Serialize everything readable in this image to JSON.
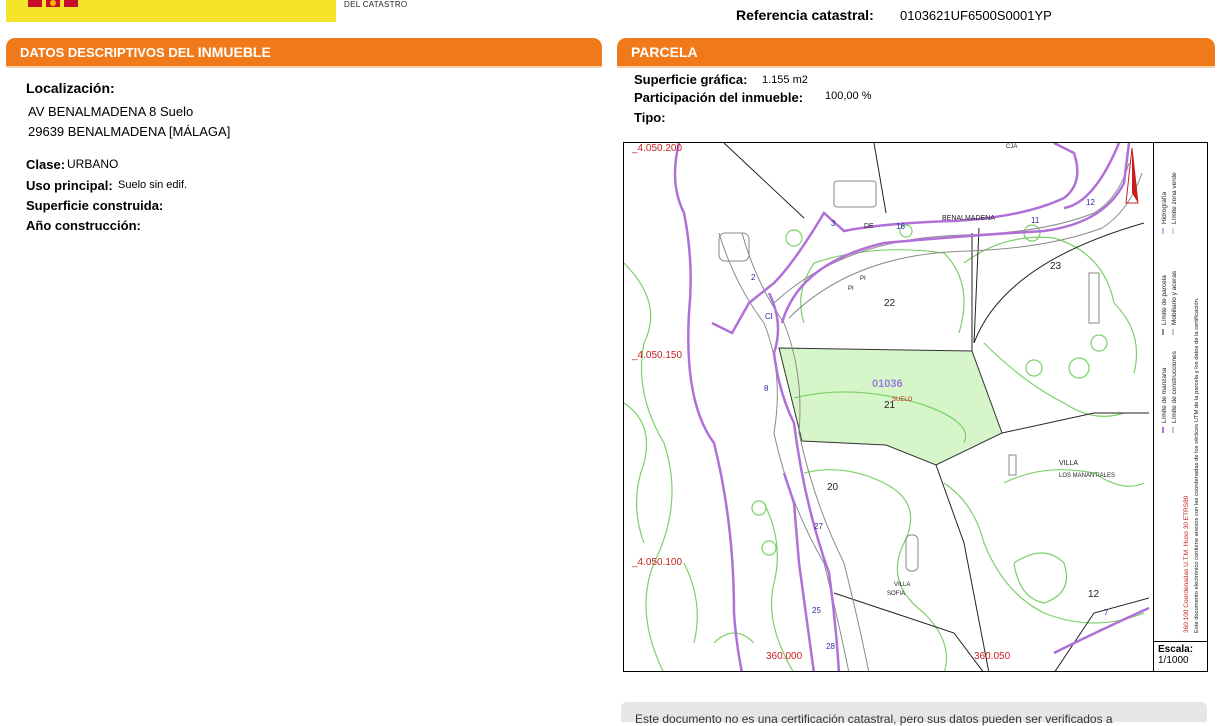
{
  "header": {
    "catastro_label": "DEL CATASTRO",
    "ref_label": "Referencia catastral:",
    "ref_value": "0103621UF6500S0001YP"
  },
  "inmueble": {
    "title_prefix": "DATOS DESCRIPTIVOS DEL ",
    "title_strong": "INMUEBLE",
    "localizacion_label": "Localización:",
    "address_line1": "AV BENALMADENA 8 Suelo",
    "address_line2": "29639 BENALMADENA [MÁLAGA]",
    "clase_label": "Clase:",
    "clase_value": "URBANO",
    "uso_label": "Uso principal:",
    "uso_value": "Suelo sin edif.",
    "superficie_label": "Superficie construida:",
    "anio_label": "Año construcción:"
  },
  "parcela": {
    "title": "PARCELA",
    "sup_label": "Superficie gráfica:",
    "sup_value": "1.155 m2",
    "part_label": "Participación del inmueble:",
    "part_value": "100,00 %",
    "tipo_label": "Tipo:"
  },
  "map": {
    "coord_y1": "_4.050.200",
    "coord_y2": "_4.050.150",
    "coord_y3": "_4.050.100",
    "coord_x1": "360.000",
    "coord_x2": "360.050",
    "parcel_ref": "01036",
    "parcel_use": "SUELO",
    "street_name": "BENALMADENA",
    "street_de": "DE",
    "villa_label": "VILLA",
    "villa_name": "LOS MANANTIALES",
    "villa2_label": "VILLA",
    "villa2_name": "SOFIA",
    "street_top": "CJA",
    "pi1": "PI",
    "pi2": "PI",
    "plots": [
      "22",
      "21",
      "20",
      "23",
      "12"
    ],
    "numbers": [
      "3",
      "16",
      "11",
      "12",
      "2",
      "Cl",
      "8",
      "27",
      "25",
      "28",
      "7"
    ],
    "legend_1": "Límite de manzana",
    "legend_2": "Límite de parcela",
    "legend_3": "Límite de construcciones",
    "legend_4": "Mobiliario y aceras",
    "legend_5": "Límite zona verde",
    "legend_6": "Hidrografía",
    "legend_note": "360.100 Coordenadas U.T.M. Huso 30 ETRS89",
    "legend_doc": "Este documento electrónico contiene anexos con las coordenadas de los vértices UTM de la parcela y los datos de la certificación.",
    "scale_label": "Escala:",
    "scale_value": "1/1000"
  },
  "footer": {
    "text": "Este documento no es una certificación catastral, pero sus datos pueden ser verificados a"
  },
  "colors": {
    "accent": "#f07a1a",
    "logo_yellow": "#f5e52a",
    "parcel_green": "#d6f5c8",
    "block_purple": "#b070d8",
    "green_lines": "#7cd06a"
  }
}
